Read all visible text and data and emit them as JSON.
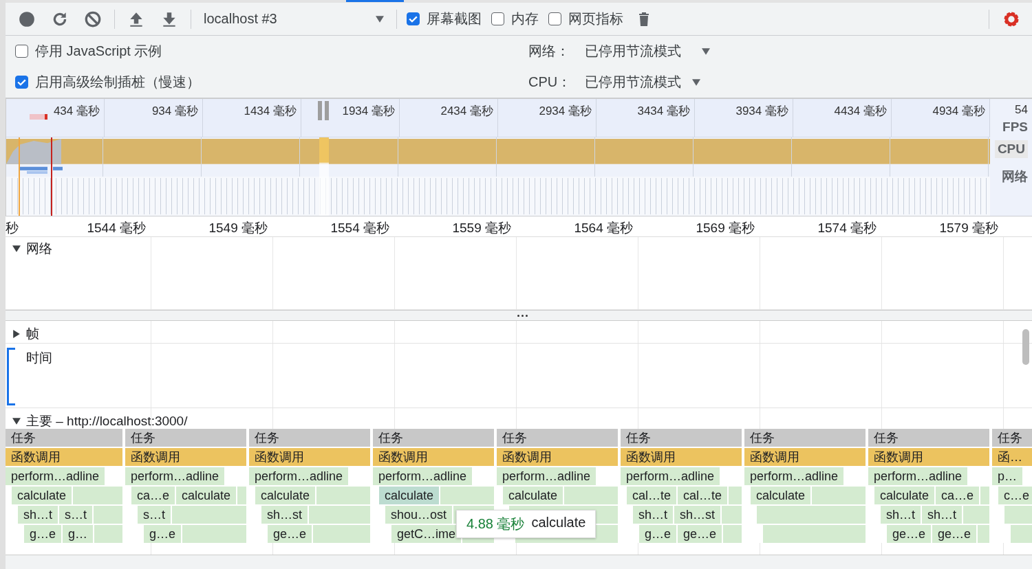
{
  "toolbar": {
    "profile": "localhost #3",
    "options": [
      {
        "label": "屏幕截图",
        "checked": true
      },
      {
        "label": "内存",
        "checked": false
      },
      {
        "label": "网页指标",
        "checked": false
      }
    ]
  },
  "settings": {
    "options": [
      {
        "label": "停用 JavaScript 示例",
        "checked": false
      },
      {
        "label": "启用高级绘制插桩（慢速）",
        "checked": true
      }
    ],
    "throttles": [
      {
        "label": "网络：",
        "value": "已停用节流模式"
      },
      {
        "label": "CPU：",
        "value": "已停用节流模式"
      }
    ]
  },
  "overview": {
    "ticks": [
      "434 毫秒",
      "934 毫秒",
      "1434 毫秒",
      "1934 毫秒",
      "2434 毫秒",
      "2934 毫秒",
      "3434 毫秒",
      "3934 毫秒",
      "4434 毫秒",
      "4934 毫秒"
    ],
    "cut_tick": "54",
    "tracks": [
      "FPS",
      "CPU",
      "网络"
    ]
  },
  "ruler": [
    "秒",
    "1544 毫秒",
    "1549 毫秒",
    "1554 毫秒",
    "1559 毫秒",
    "1564 毫秒",
    "1569 毫秒",
    "1574 毫秒",
    "1579 毫秒"
  ],
  "network_track": {
    "label": "网络",
    "expanded": true
  },
  "frames_track": {
    "label": "帧",
    "expanded": false
  },
  "timings_track": {
    "label": "时间"
  },
  "main_track": {
    "label": "主要 – http://localhost:3000/",
    "expanded": true
  },
  "flame": {
    "columns": [
      {
        "task": "任务",
        "call": "函数调用",
        "rows": [
          [
            {
              "label": "perform…adline",
              "selected": false
            }
          ],
          [
            {
              "label": "calculate",
              "selected": false
            }
          ],
          [
            {
              "label": "sh…t",
              "selected": false
            },
            {
              "label": "s…t",
              "selected": false
            }
          ],
          [
            {
              "label": "g…e",
              "selected": false
            },
            {
              "label": "g…",
              "selected": false
            }
          ]
        ]
      },
      {
        "task": "任务",
        "call": "函数调用",
        "rows": [
          [
            {
              "label": "perform…adline",
              "selected": false
            }
          ],
          [
            {
              "label": "ca…e",
              "selected": false
            },
            {
              "label": "calculate",
              "selected": false
            }
          ],
          [
            {
              "label": "s…t",
              "selected": false
            }
          ],
          [
            {
              "label": "g…e",
              "selected": false
            }
          ]
        ]
      },
      {
        "task": "任务",
        "call": "函数调用",
        "rows": [
          [
            {
              "label": "perform…adline",
              "selected": false
            }
          ],
          [
            {
              "label": "calculate",
              "selected": false
            }
          ],
          [
            {
              "label": "sh…st",
              "selected": false
            }
          ],
          [
            {
              "label": "ge…e",
              "selected": false
            }
          ]
        ]
      },
      {
        "task": "任务",
        "call": "函数调用",
        "rows": [
          [
            {
              "label": "perform…adline",
              "selected": false
            }
          ],
          [
            {
              "label": "calculate",
              "selected": true
            }
          ],
          [
            {
              "label": "shou…ost",
              "selected": false
            }
          ],
          [
            {
              "label": "getC…ime",
              "selected": false
            }
          ]
        ]
      },
      {
        "task": "任务",
        "call": "函数调用",
        "rows": [
          [
            {
              "label": "perform…adline",
              "selected": false
            }
          ],
          [
            {
              "label": "calculate",
              "selected": false
            }
          ]
        ]
      },
      {
        "task": "任务",
        "call": "函数调用",
        "rows": [
          [
            {
              "label": "perform…adline",
              "selected": false
            }
          ],
          [
            {
              "label": "cal…te",
              "selected": false
            },
            {
              "label": "cal…te",
              "selected": false
            }
          ],
          [
            {
              "label": "sh…t",
              "selected": false
            },
            {
              "label": "sh…st",
              "selected": false
            }
          ],
          [
            {
              "label": "g…e",
              "selected": false
            },
            {
              "label": "ge…e",
              "selected": false
            }
          ]
        ]
      },
      {
        "task": "任务",
        "call": "函数调用",
        "rows": [
          [
            {
              "label": "perform…adline",
              "selected": false
            }
          ],
          [
            {
              "label": "calculate",
              "selected": false
            }
          ]
        ]
      },
      {
        "task": "任务",
        "call": "函数调用",
        "rows": [
          [
            {
              "label": "perform…adline",
              "selected": false
            }
          ],
          [
            {
              "label": "calculate",
              "selected": false
            },
            {
              "label": "ca…e",
              "selected": false
            }
          ],
          [
            {
              "label": "sh…t",
              "selected": false
            },
            {
              "label": "sh…t",
              "selected": false
            }
          ],
          [
            {
              "label": "ge…e",
              "selected": false
            },
            {
              "label": "ge…e",
              "selected": false
            }
          ]
        ]
      },
      {
        "task": "任务",
        "call": "函…",
        "rows": [
          [
            {
              "label": "p…",
              "selected": false
            }
          ],
          [
            {
              "label": "c…e",
              "selected": false
            }
          ]
        ]
      }
    ],
    "tooltip": {
      "time": "4.88 毫秒",
      "name": "calculate"
    }
  }
}
